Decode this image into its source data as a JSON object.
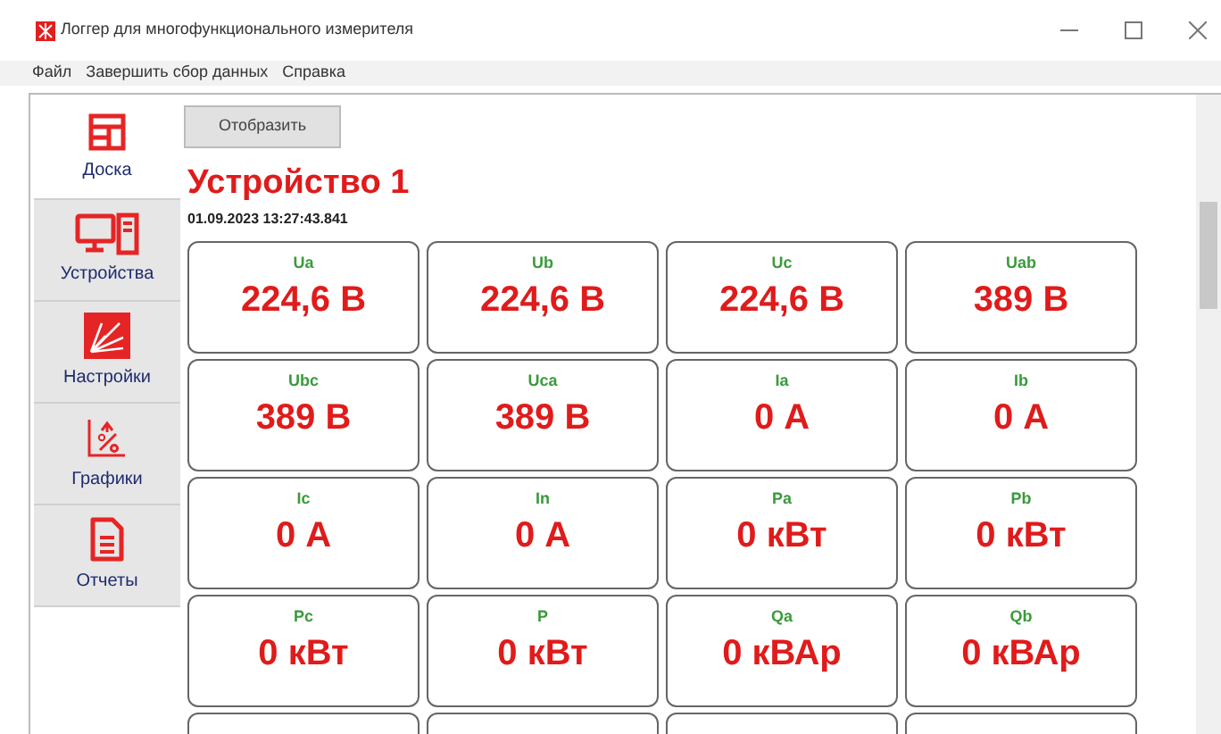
{
  "window": {
    "title": "Логгер для многофункционального измерителя"
  },
  "menu": [
    "Файл",
    "Завершить сбор данных",
    "Справка"
  ],
  "sidebar": {
    "items": [
      {
        "label": "Доска",
        "kind": "dashboard",
        "selected": true
      },
      {
        "label": "Устройства",
        "kind": "devices",
        "selected": false
      },
      {
        "label": "Настройки",
        "kind": "settings",
        "selected": false
      },
      {
        "label": "Графики",
        "kind": "charts",
        "selected": false
      },
      {
        "label": "Отчеты",
        "kind": "reports",
        "selected": false
      }
    ]
  },
  "toolbar": {
    "button": "Отобразить"
  },
  "device": {
    "title": "Устройство 1",
    "timestamp": "01.09.2023 13:27:43.841"
  },
  "cards": [
    {
      "kind": "metric",
      "label": "Ua",
      "value": "224,6 В"
    },
    {
      "kind": "metric",
      "label": "Ub",
      "value": "224,6 В"
    },
    {
      "kind": "metric",
      "label": "Uc",
      "value": "224,6 В"
    },
    {
      "kind": "metric",
      "label": "Uab",
      "value": "389 В"
    },
    {
      "kind": "metric",
      "label": "Ubc",
      "value": "389 В"
    },
    {
      "kind": "metric",
      "label": "Uca",
      "value": "389 В"
    },
    {
      "kind": "metric",
      "label": "Ia",
      "value": "0 А"
    },
    {
      "kind": "metric",
      "label": "Ib",
      "value": "0 А"
    },
    {
      "kind": "metric",
      "label": "Ic",
      "value": "0 А"
    },
    {
      "kind": "metric",
      "label": "In",
      "value": "0 А"
    },
    {
      "kind": "metric",
      "label": "Pa",
      "value": "0 кВт"
    },
    {
      "kind": "metric",
      "label": "Pb",
      "value": "0 кВт"
    },
    {
      "kind": "metric",
      "label": "Pc",
      "value": "0 кВт"
    },
    {
      "kind": "metric",
      "label": "P",
      "value": "0 кВт"
    },
    {
      "kind": "metric",
      "label": "Qa",
      "value": "0 кВАр"
    },
    {
      "kind": "metric",
      "label": "Qb",
      "value": "0 кВАр"
    },
    {
      "kind": "partial"
    },
    {
      "kind": "partial"
    },
    {
      "kind": "partial"
    },
    {
      "kind": "partial"
    }
  ]
}
